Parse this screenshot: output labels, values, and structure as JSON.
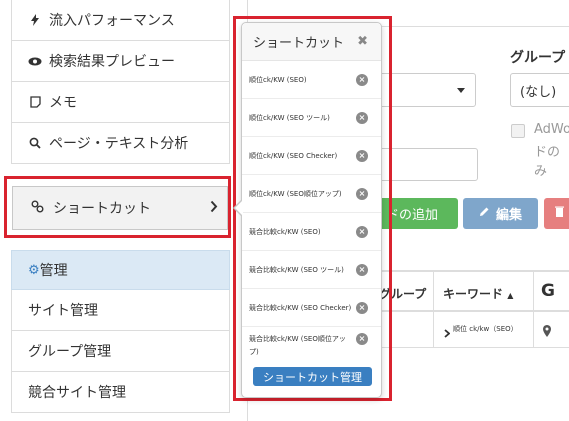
{
  "sidebar": {
    "items": [
      {
        "label": "流入パフォーマンス",
        "icon": "bolt-icon"
      },
      {
        "label": "検索結果プレビュー",
        "icon": "eye-icon"
      },
      {
        "label": "メモ",
        "icon": "note-icon"
      },
      {
        "label": "ページ・テキスト分析",
        "icon": "zoom-icon"
      }
    ],
    "shortcut": {
      "label": "ショートカット",
      "icon": "link-icon"
    },
    "admin_header": {
      "label": "管理",
      "icon": "gear-icon"
    },
    "admin_items": [
      "サイト管理",
      "グループ管理",
      "競合サイト管理"
    ]
  },
  "popover": {
    "title": "ショートカット",
    "items": [
      "順位ck/KW (SEO)",
      "順位ck/KW (SEO ツール)",
      "順位ck/KW (SEO Checker)",
      "順位ck/KW (SEO順位アップ)",
      "競合比較ck/KW (SEO)",
      "競合比較ck/KW (SEO ツール)",
      "競合比較ck/KW (SEO Checker)",
      "競合比較ck/KW (SEO順位アップ)"
    ],
    "manage_button": "ショートカット管理"
  },
  "main": {
    "group_label": "グループ",
    "group_select_value": "(なし)",
    "checkbox_text_1": "AdWo",
    "checkbox_text_2": "ドのみ",
    "add_button": "ドの追加",
    "edit_button": "編集",
    "table": {
      "col_group": "グループ",
      "col_keyword": "キーワード",
      "col_g": "G",
      "row_keyword": "順位 ck/kw（SEO）"
    }
  },
  "colors": {
    "highlight": "#d9232f",
    "primary": "#3a7fc1",
    "success": "#5cb85c",
    "danger": "#e67f7f"
  }
}
